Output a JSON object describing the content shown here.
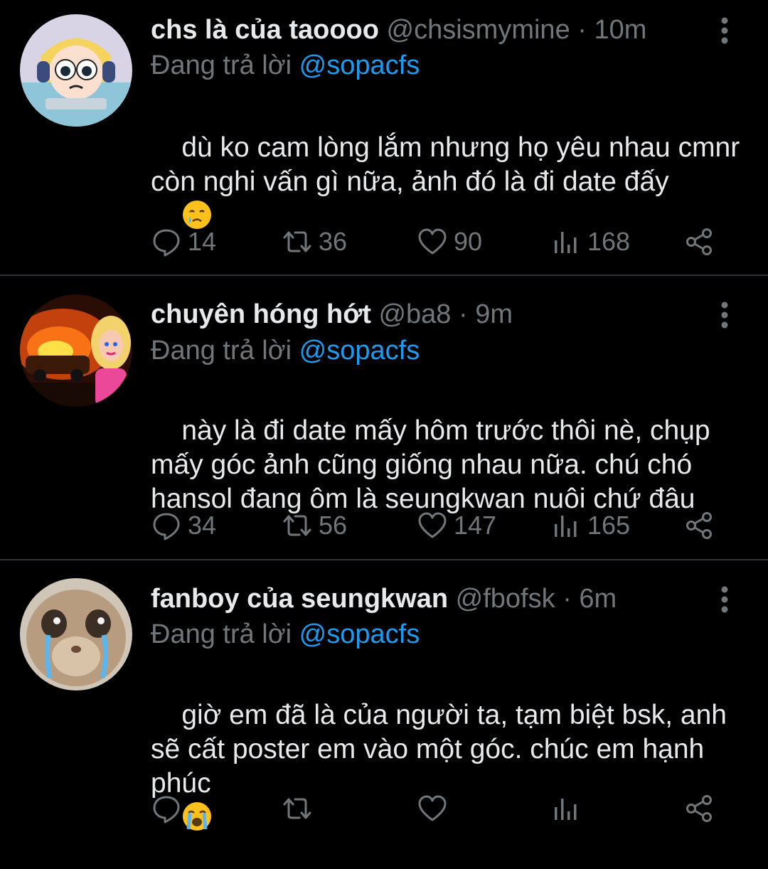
{
  "tweets": [
    {
      "name": "chs là của taoooo",
      "handle": "@chsismymine",
      "separator": "·",
      "time": "10m",
      "reply_prefix": "Đang trả lời",
      "reply_to": "@sopacfs",
      "text": "dù ko cam lòng lắm nhưng họ yêu nhau cmnr còn nghi vấn gì nữa, ảnh đó là đi date đấy",
      "emoji": "crying-face",
      "replies": "14",
      "retweets": "36",
      "likes": "90",
      "views": "168"
    },
    {
      "name": "chuyên hóng hớt",
      "handle": "@ba8",
      "separator": "·",
      "time": "9m",
      "reply_prefix": "Đang trả lời",
      "reply_to": "@sopacfs",
      "text": "này là đi date mấy hôm trước thôi nè, chụp mấy góc ảnh cũng giống nhau nữa. chú chó hansol đang ôm là seungkwan nuôi chứ đâu",
      "replies": "34",
      "retweets": "56",
      "likes": "147",
      "views": "165"
    },
    {
      "name": "fanboy của seungkwan",
      "handle": "@fbofsk",
      "separator": "·",
      "time": "6m",
      "reply_prefix": "Đang trả lời",
      "reply_to": "@sopacfs",
      "text": "giờ em đã là của người ta, tạm biệt bsk, anh sẽ cất poster em vào một góc. chúc em hạnh phúc",
      "emoji": "loudly-crying-face",
      "replies": "",
      "retweets": "",
      "likes": "",
      "views": ""
    }
  ],
  "colors": {
    "background": "#000000",
    "text": "#e7e9ea",
    "secondary": "#71767b",
    "link": "#1d9bf0",
    "divider": "#2f3336"
  },
  "icons": [
    "reply-icon",
    "retweet-icon",
    "like-icon",
    "views-icon",
    "share-icon",
    "more-icon"
  ]
}
